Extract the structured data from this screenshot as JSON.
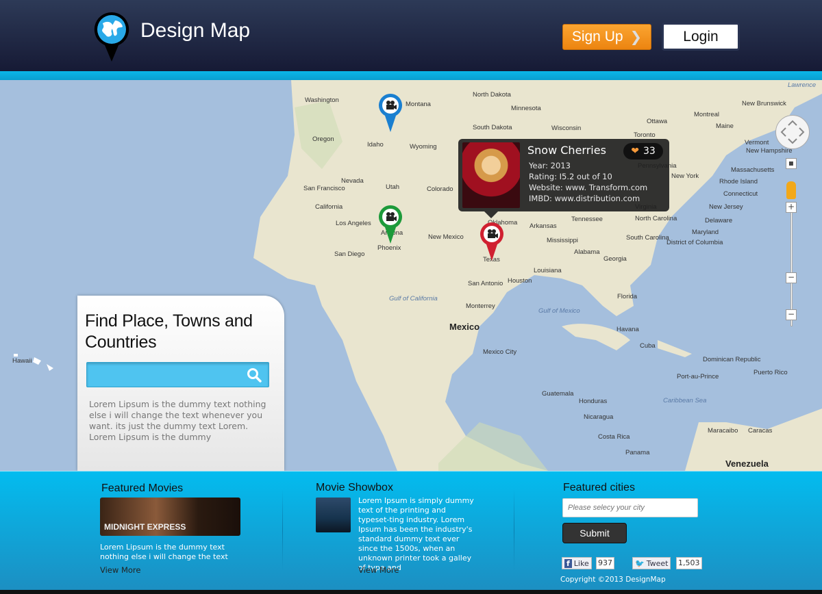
{
  "header": {
    "brand_bold": "Design",
    "brand_light": " Map",
    "signup_label": "Sign Up",
    "login_label": "Login",
    "accent_orange": "#f59a22"
  },
  "map": {
    "labels": [
      "Washington",
      "Oregon",
      "Idaho",
      "Montana",
      "North Dakota",
      "Minnesota",
      "South Dakota",
      "Wyoming",
      "Wisconsin",
      "Nevada",
      "Utah",
      "Colorado",
      "San Francisco",
      "California",
      "Los Angeles",
      "San Diego",
      "Arizona",
      "Phoenix",
      "New Mexico",
      "Oklahoma",
      "Arkansas",
      "Texas",
      "San Antonio",
      "Houston",
      "Louisiana",
      "Mississippi",
      "Alabama",
      "Georgia",
      "Tennessee",
      "North Carolina",
      "South Carolina",
      "Florida",
      "Gulf of California",
      "Gulf of Mexico",
      "Mexico",
      "Monterrey",
      "Mexico City",
      "Havana",
      "Cuba",
      "Dominican Republic",
      "Port-au-Prince",
      "Puerto Rico",
      "Caribbean Sea",
      "Guatemala",
      "Honduras",
      "Nicaragua",
      "Costa Rica",
      "Panama",
      "Maracaibo",
      "Caracas",
      "Venezuela",
      "Hawaii",
      "Ottawa",
      "Toronto",
      "Montreal",
      "Maine",
      "Vermont",
      "New Hampshire",
      "Massachusetts",
      "Rhode Island",
      "Connecticut",
      "New Jersey",
      "Delaware",
      "Maryland",
      "District of Columbia",
      "New York",
      "Pennsylvania",
      "Virginia",
      "New Brunswick",
      "Lawrence"
    ],
    "big_labels": [
      "Mexico",
      "Venezuela"
    ],
    "sea_labels": [
      "Gulf of California",
      "Gulf of Mexico",
      "Caribbean Sea",
      "Lawrence"
    ],
    "pins": [
      {
        "color": "#1a7fd0",
        "icon": "movie-camera-icon"
      },
      {
        "color": "#1d9a3a",
        "icon": "movie-camera-icon"
      },
      {
        "color": "#d02030",
        "icon": "movie-camera-icon"
      }
    ],
    "zoom_plus": "+",
    "zoom_minus": "−"
  },
  "tooltip": {
    "title": "Snow Cherries",
    "likes": "33",
    "year": "Year: 2013",
    "rating": "Rating: I5.2 out of 10",
    "website": "Website: www. Transform.com",
    "imbd": "IMBD: www.distribution.com"
  },
  "search": {
    "title": "Find Place, Towns and Countries",
    "placeholder": "",
    "description": "Lorem Lipsum is the dummy text nothing else i will change the text whenever you want. its just the dummy text Lorem. Lorem Lipsum is the dummy"
  },
  "footer": {
    "featured_movies": {
      "heading": "Featured Movies",
      "image_caption": "MIDNIGHT EXPRESS",
      "text": "Lorem Lipsum is the dummy text nothing else i will change the text whenever you",
      "view_more": "View More"
    },
    "showbox": {
      "heading": "Movie Showbox",
      "text": "Lorem Ipsum is simply dummy text of the printing and typeset-ting industry. Lorem Ipsum has been the industry's standard dummy text ever since the 1500s, when an unknown printer took a galley of type and",
      "view_more": "View More"
    },
    "cities": {
      "heading": "Featured cities",
      "placeholder": "Please selecy your city",
      "submit": "Submit",
      "like_label": "Like",
      "like_count": "937",
      "tweet_label": "Tweet",
      "tweet_count": "1,503",
      "copyright": "Copyright ©2013 DesignMap"
    }
  }
}
